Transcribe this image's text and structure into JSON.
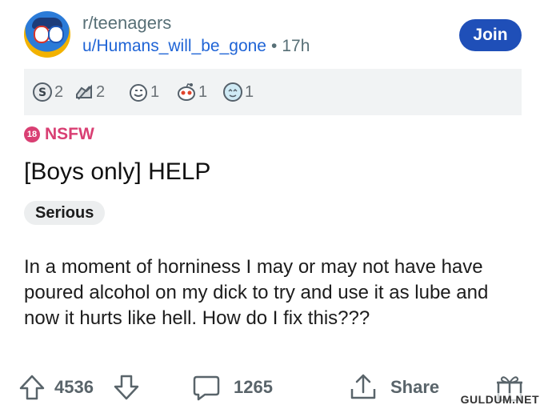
{
  "post": {
    "subreddit": "r/teenagers",
    "username": "u/Humans_will_be_gone",
    "separator": "•",
    "age": "17h",
    "join_label": "Join",
    "nsfw_badge": "18",
    "nsfw_label": "NSFW",
    "title": "[Boys only] HELP",
    "flair": "Serious",
    "body": "In a moment of horniness I may or may not have have poured alcohol on my dick to try and use it as lube and now it hurts like hell. How do I fix this???"
  },
  "awards": [
    {
      "icon": "silver-award-icon",
      "count": "2"
    },
    {
      "icon": "helpful-award-icon",
      "count": "2"
    },
    {
      "icon": "wholesome-award-icon",
      "count": "1"
    },
    {
      "icon": "snoo-award-icon",
      "count": "1"
    },
    {
      "icon": "starstruck-award-icon",
      "count": "1"
    }
  ],
  "actions": {
    "upvotes": "4536",
    "comments": "1265",
    "share_label": "Share"
  },
  "watermark": "GULDUM.NET",
  "colors": {
    "accent": "#1f4fb8",
    "link": "#1f64d6",
    "nsfw": "#d93f73",
    "muted": "#576f76"
  }
}
